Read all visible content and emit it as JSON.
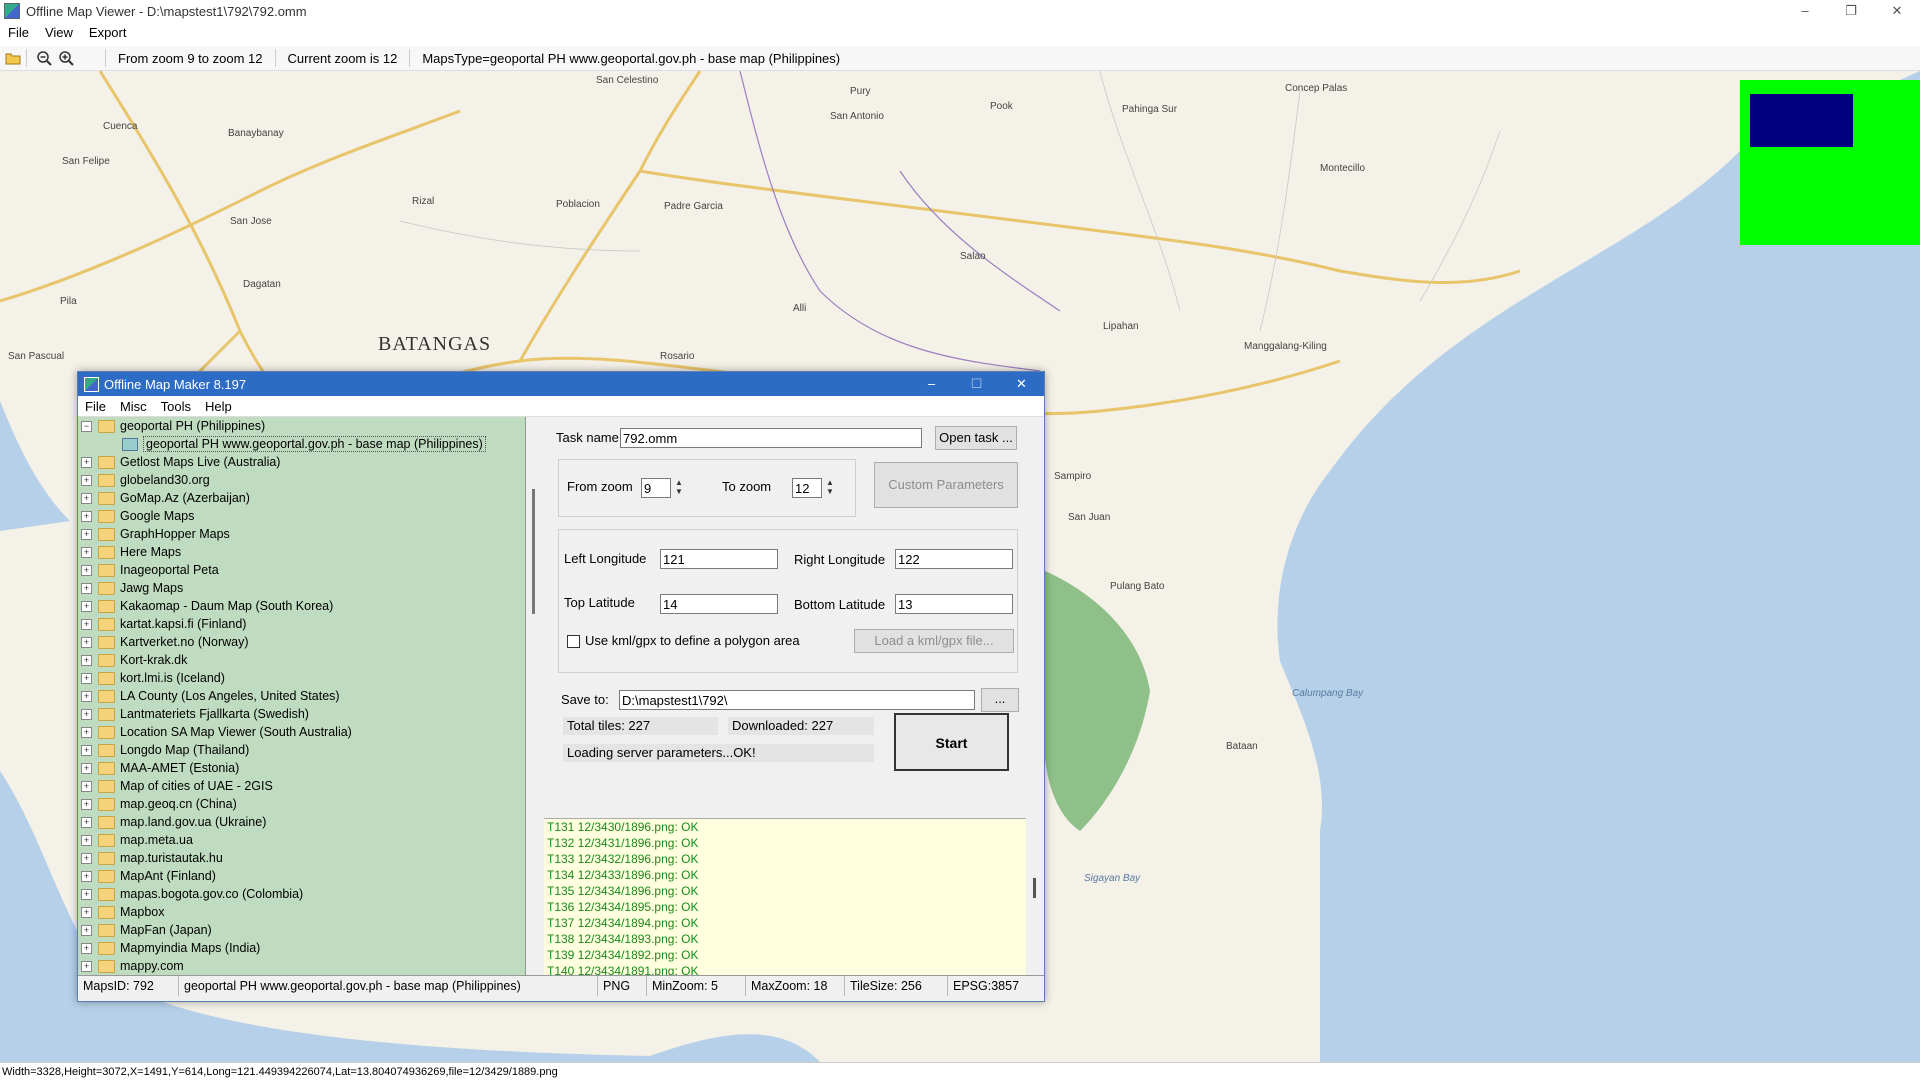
{
  "window": {
    "title": "Offline Map Viewer - D:\\mapstest1\\792\\792.omm",
    "controls": {
      "minimize": "–",
      "restore": "❐",
      "close": "✕"
    }
  },
  "menubar": [
    "File",
    "View",
    "Export"
  ],
  "toolbar": {
    "icons": [
      "open-folder-icon",
      "zoom-out-icon",
      "zoom-in-icon"
    ],
    "zoom_range": "From zoom 9 to zoom 12",
    "current_zoom": "Current zoom is 12",
    "maps_type": "MapsType=geoportal PH www.geoportal.gov.ph - base map (Philippines)"
  },
  "map": {
    "labels": [
      "Cuenca",
      "Banaybanay",
      "San Felipe",
      "San Jose",
      "Rizal",
      "Poblacion",
      "Padre Garcia",
      "Dagatan",
      "BATANGAS",
      "Rosario",
      "San Celestino",
      "San Antonio",
      "Pury",
      "Pook",
      "Pahinga Sur",
      "Concep Palas",
      "Montecillo",
      "Salao",
      "Lipahan",
      "Manggalang-Kiling",
      "Pila",
      "San Pascual",
      "Alli",
      "San Juan",
      "Sampiro",
      "Pulang Bato",
      "Bataan",
      "Calumpang Bay",
      "Sigayan Bay"
    ],
    "colors": {
      "land": "#f4f1e8",
      "water": "#b5d0e8",
      "roads": "#e8c46a",
      "forest": "#8fc08a"
    }
  },
  "minimap": {
    "bg": "#00ff00",
    "viewport": "#000080"
  },
  "statusbar": "Width=3328,Height=3072,X=1491,Y=614,Long=121.449394226074,Lat=13.804074936269,file=12/3429/1889.png",
  "dialog": {
    "title": "Offline Map Maker 8.197",
    "controls": {
      "minimize": "–",
      "maximize": "☐",
      "close": "✕"
    },
    "menu": [
      "File",
      "Misc",
      "Tools",
      "Help"
    ],
    "tree": {
      "expanded": {
        "label": "geoportal PH (Philippines)",
        "child": "geoportal PH www.geoportal.gov.ph - base map (Philippines)"
      },
      "items": [
        "Getlost Maps Live (Australia)",
        "globeland30.org",
        "GoMap.Az (Azerbaijan)",
        "Google Maps",
        "GraphHopper Maps",
        "Here Maps",
        "Inageoportal Peta",
        "Jawg Maps",
        "Kakaomap - Daum Map (South Korea)",
        "kartat.kapsi.fi (Finland)",
        "Kartverket.no (Norway)",
        "Kort-krak.dk",
        "kort.lmi.is (Iceland)",
        "LA County (Los Angeles, United States)",
        "Lantmateriets Fjallkarta (Swedish)",
        "Location SA Map Viewer (South Australia)",
        "Longdo Map (Thailand)",
        "MAA-AMET (Estonia)",
        "Map of cities of UAE - 2GIS",
        "map.geoq.cn (China)",
        "map.land.gov.ua (Ukraine)",
        "map.meta.ua",
        "map.turistautak.hu",
        "MapAnt (Finland)",
        "mapas.bogota.gov.co (Colombia)",
        "Mapbox",
        "MapFan (Japan)",
        "Mapmyindia Maps (India)",
        "mappy.com"
      ]
    },
    "form": {
      "task_name_label": "Task name",
      "task_name_value": "792.omm",
      "open_task_label": "Open task ...",
      "from_zoom_label": "From zoom",
      "from_zoom_value": "9",
      "to_zoom_label": "To zoom",
      "to_zoom_value": "12",
      "custom_params_label": "Custom Parameters",
      "left_lon_label": "Left Longitude",
      "left_lon_value": "121",
      "right_lon_label": "Right Longitude",
      "right_lon_value": "122",
      "top_lat_label": "Top Latitude",
      "top_lat_value": "14",
      "bottom_lat_label": "Bottom Latitude",
      "bottom_lat_value": "13",
      "kml_label": "Use kml/gpx to define a polygon area",
      "kml_button": "Load a kml/gpx file...",
      "save_to_label": "Save to:",
      "save_to_value": "D:\\mapstest1\\792\\",
      "browse_label": "...",
      "total_tiles": "Total tiles: 227",
      "downloaded": "Downloaded: 227",
      "loading": "Loading server parameters...OK!",
      "start_label": "Start"
    },
    "log": [
      "T131 12/3430/1896.png: OK",
      "T132 12/3431/1896.png: OK",
      "T133 12/3432/1896.png: OK",
      "T134 12/3433/1896.png: OK",
      "T135 12/3434/1896.png: OK",
      "T136 12/3434/1895.png: OK",
      "T137 12/3434/1894.png: OK",
      "T138 12/3434/1893.png: OK",
      "T139 12/3434/1892.png: OK",
      "T140 12/3434/1891.png: OK"
    ],
    "status": {
      "maps_id": "MapsID: 792",
      "map_name": "geoportal PH www.geoportal.gov.ph - base map (Philippines)",
      "format": "PNG",
      "min_zoom": "MinZoom: 5",
      "max_zoom": "MaxZoom: 18",
      "tile_size": "TileSize: 256",
      "epsg": "EPSG:3857"
    }
  }
}
